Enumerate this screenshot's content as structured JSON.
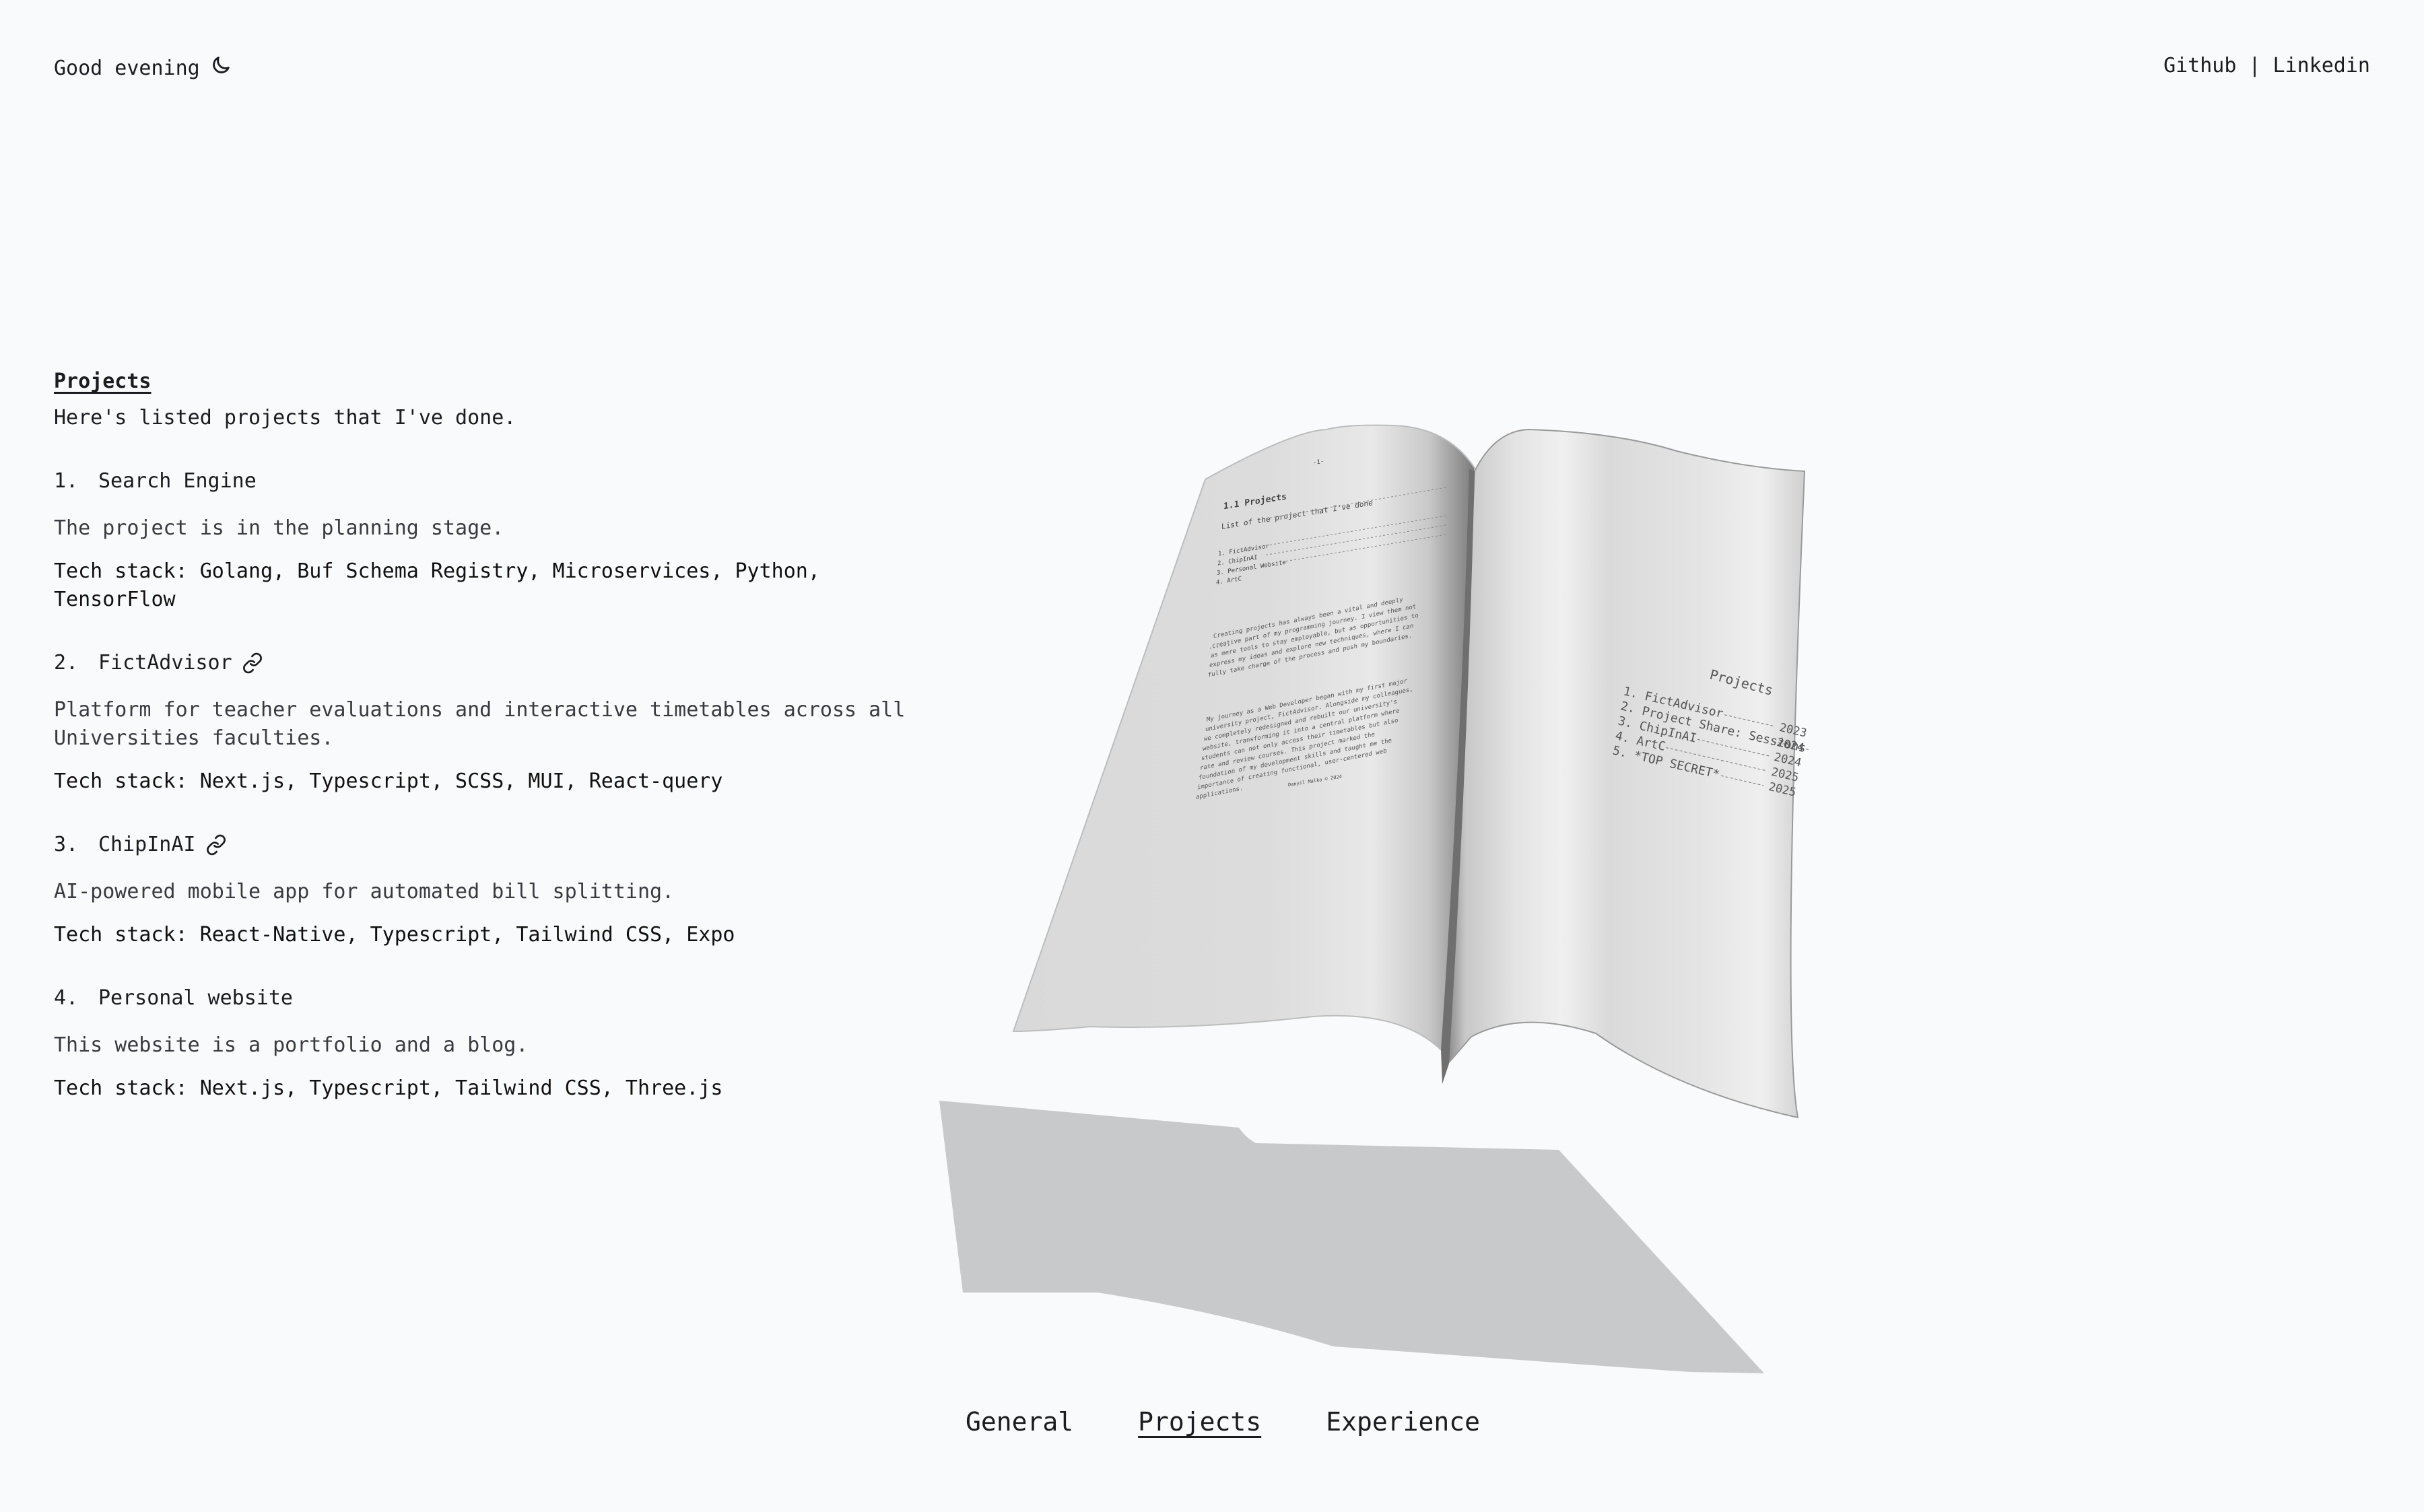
{
  "header": {
    "greeting": "Good evening",
    "greeting_icon": "moon-icon",
    "links": [
      {
        "label": "Github"
      },
      {
        "separator": "|"
      },
      {
        "label": "Linkedin"
      }
    ]
  },
  "section": {
    "title": "Projects",
    "intro": "Here's listed projects that I've done."
  },
  "projects": [
    {
      "number": "1.",
      "name": "Search Engine",
      "description": "The project is in the planning stage.",
      "stack": "Tech stack: Golang, Buf Schema Registry, Microservices, Python, TensorFlow"
    },
    {
      "number": "2.",
      "name": "FictAdvisor",
      "has_link": true,
      "description": "Platform for teacher evaluations and interactive timetables across all Universities faculties.",
      "stack": "Tech stack: Next.js, Typescript, SCSS, MUI, React-query"
    },
    {
      "number": "3.",
      "name": "ChipInAI",
      "has_link": true,
      "description": "AI-powered mobile app for automated bill splitting.",
      "stack": "Tech stack: React-Native, Typescript, Tailwind CSS, Expo"
    },
    {
      "number": "4.",
      "name": "Personal website",
      "description": "This website is a portfolio and a blog.",
      "stack": "Tech stack: Next.js, Typescript, Tailwind CSS, Three.js"
    }
  ],
  "book": {
    "left_page": {
      "page_number": "-1-",
      "heading": "1.1 Projects",
      "subheading": "List of the project that I've done",
      "toc": [
        "1. FictAdvisor",
        "2. ChipInAI",
        "3. Personal Website",
        "4. ArtC"
      ],
      "paragraph1": "Creating projects has always been a vital and deeply creative part of my programming journey. I view them not as mere tools to stay employable, but as opportunities to express my ideas and explore new techniques, where I can fully take charge of the process and push my boundaries.",
      "divider": "......",
      "paragraph2": "My journey as a Web Developer began with my first major university project, FictAdvisor. Alongside my colleagues, we completely redesigned and rebuilt our university's website, transforming it into a central platform where students can not only access their timetables but also rate and review courses. This project marked the foundation of my development skills and taught me the importance of creating functional, user-centered web applications.",
      "footer": "Danyil Malko © 2024"
    },
    "right_page": {
      "heading": "Projects",
      "items": [
        {
          "label": "1. FictAdvisor",
          "year": "2023"
        },
        {
          "label": "2. Project Share: Sessions",
          "year": "2024"
        },
        {
          "label": "3. ChipInAI",
          "year": "2024"
        },
        {
          "label": "4. ArtC",
          "year": "2025"
        },
        {
          "label": "5. *TOP SECRET*",
          "year": "2025"
        }
      ]
    }
  },
  "nav": {
    "items": [
      "General",
      "Projects",
      "Experience"
    ],
    "active": "Projects"
  }
}
